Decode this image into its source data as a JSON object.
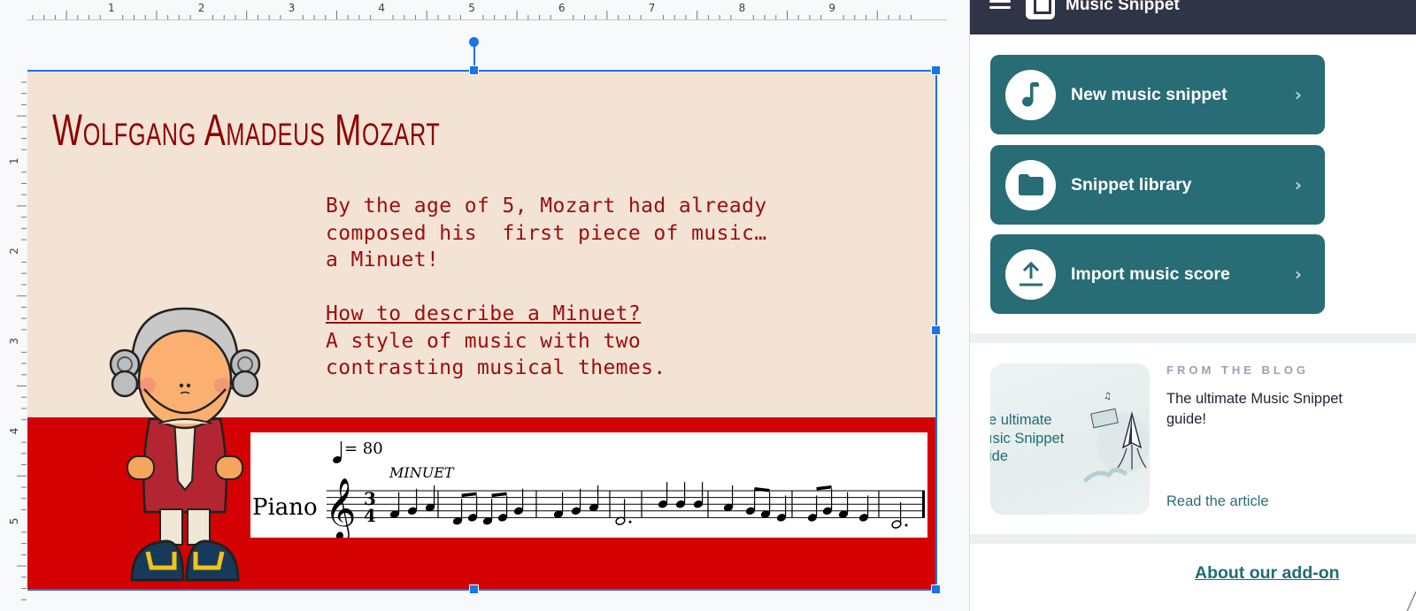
{
  "ruler": {
    "top_numbers": [
      "1",
      "2",
      "3",
      "4",
      "5",
      "6",
      "7",
      "8",
      "9"
    ],
    "left_numbers": [
      "1",
      "2",
      "3",
      "4",
      "5"
    ]
  },
  "slide": {
    "title": "Wolfgang Amadeus Mozart",
    "body_line1": "By the age of 5, Mozart had already",
    "body_line2": "composed his  first piece of music…",
    "body_line3": "a Minuet!",
    "question": "How to describe a Minuet?",
    "answer_line1": "A style of music with two",
    "answer_line2": "contrasting musical themes.",
    "colors": {
      "background": "#f3e3d5",
      "band": "#d30101",
      "title_text": "#8e0000",
      "body_text": "#9c0d0d"
    },
    "score": {
      "tempo_equals": "= 80",
      "piece_title": "MINUET",
      "instrument": "Piano",
      "time_signature_top": "3",
      "time_signature_bottom": "4"
    },
    "image_label": "Mozart cartoon illustration"
  },
  "sidebar": {
    "app_title": "Music Snippet",
    "header_color": "#2f3447",
    "accent_color": "#286c75",
    "actions": [
      {
        "label": "New music snippet",
        "icon": "music-note-icon"
      },
      {
        "label": "Snippet library",
        "icon": "folder-icon"
      },
      {
        "label": "Import music score",
        "icon": "upload-icon"
      }
    ],
    "blog": {
      "kicker": "FROM THE BLOG",
      "title": "The ultimate Music Snippet guide!",
      "thumbnail_text": "e ultimate\nısic Snippet\nide",
      "link": "Read the article"
    },
    "about_link": "About our add-on"
  }
}
